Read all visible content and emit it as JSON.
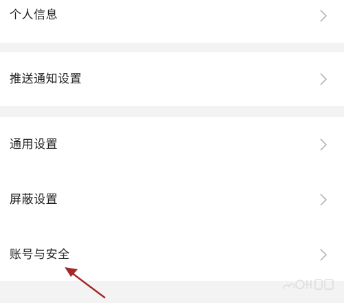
{
  "settings": {
    "items": [
      {
        "label": "个人信息"
      },
      {
        "label": "推送通知设置"
      },
      {
        "label": "通用设置"
      },
      {
        "label": "屏蔽设置"
      },
      {
        "label": "账号与安全"
      }
    ]
  },
  "colors": {
    "background": "#f3f3f3",
    "card": "#ffffff",
    "text": "#222222",
    "chevron": "#b5b5b5",
    "annotation_arrow": "#a32828"
  },
  "icons": {
    "chevron": "chevron-right-icon",
    "annotation": "red-arrow-annotation",
    "watermark": "baidu-jingyan-watermark"
  }
}
